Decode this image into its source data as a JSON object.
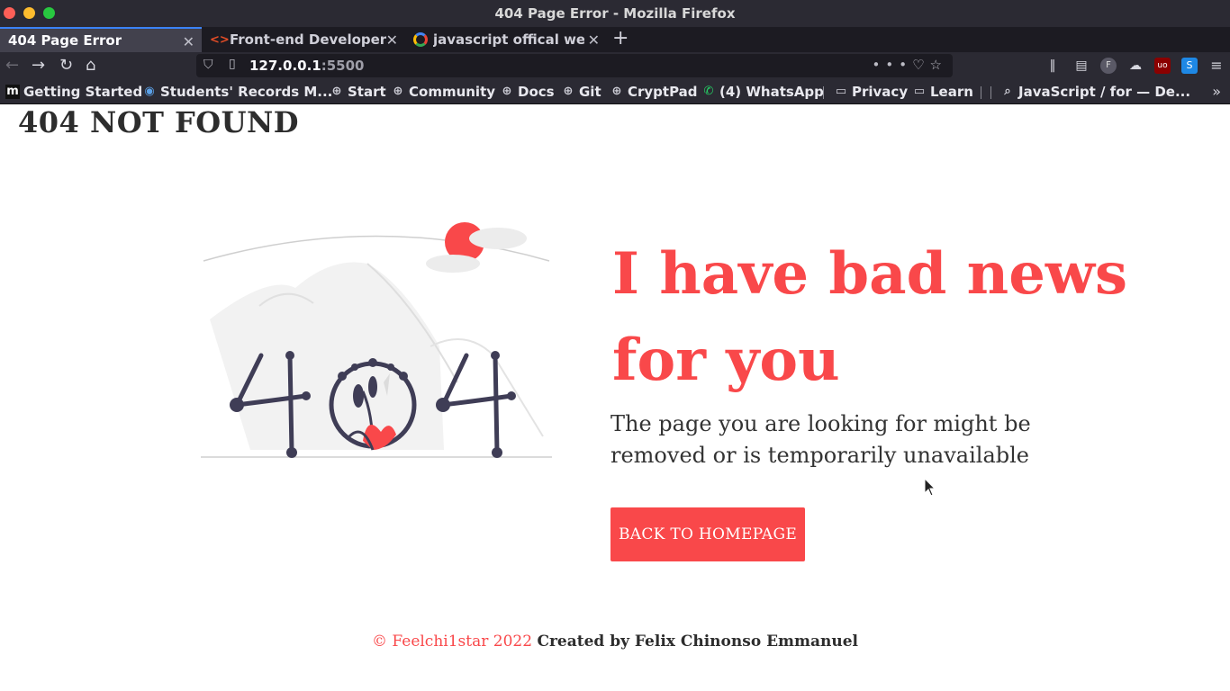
{
  "window": {
    "title": "404 Page Error - Mozilla Firefox"
  },
  "tabs": [
    {
      "label": "404 Page Error",
      "active": true,
      "icon": "none"
    },
    {
      "label": "Front-end Developer",
      "active": false,
      "icon": "code-icon"
    },
    {
      "label": "javascript offical web",
      "active": false,
      "icon": "google-icon"
    }
  ],
  "tab_close_glyph": "✕",
  "new_tab_glyph": "+",
  "address": {
    "host": "127.0.0.1",
    "port": ":5500"
  },
  "bookmarks": [
    {
      "label": "Getting Started",
      "icon": "m-icon"
    },
    {
      "label": "Students' Records M...",
      "icon": "globe-icon"
    },
    {
      "label": "Start",
      "icon": "globe-icon"
    },
    {
      "label": "Community",
      "icon": "globe-icon"
    },
    {
      "label": "Docs",
      "icon": "globe-icon"
    },
    {
      "label": "Git",
      "icon": "globe-icon"
    },
    {
      "label": "CryptPad",
      "icon": "globe-icon"
    },
    {
      "label": "(4) WhatsApp",
      "icon": "whatsapp-icon"
    },
    {
      "label": "Privacy",
      "icon": "folder-icon"
    },
    {
      "label": "Learn",
      "icon": "folder-icon"
    },
    {
      "label": "JavaScript / for — De...",
      "icon": "search-icon"
    }
  ],
  "page": {
    "corner_title": "404 NOT FOUND",
    "headline": "I have bad news for you",
    "subtext": "The page you are looking for might be removed or is temporarily unavailable",
    "button_label": "BACK TO HOMEPAGE",
    "illustration_text": "404",
    "footer_copyright": "© Feelchi1star 2022",
    "footer_credit": "Created by Felix Chinonso Emmanuel"
  },
  "colors": {
    "accent": "#f9484a",
    "text_dark": "#2d2d2d",
    "chrome_bg": "#2b2a33",
    "tab_strip_bg": "#1c1b22",
    "illustration_ink": "#3f3d56"
  }
}
